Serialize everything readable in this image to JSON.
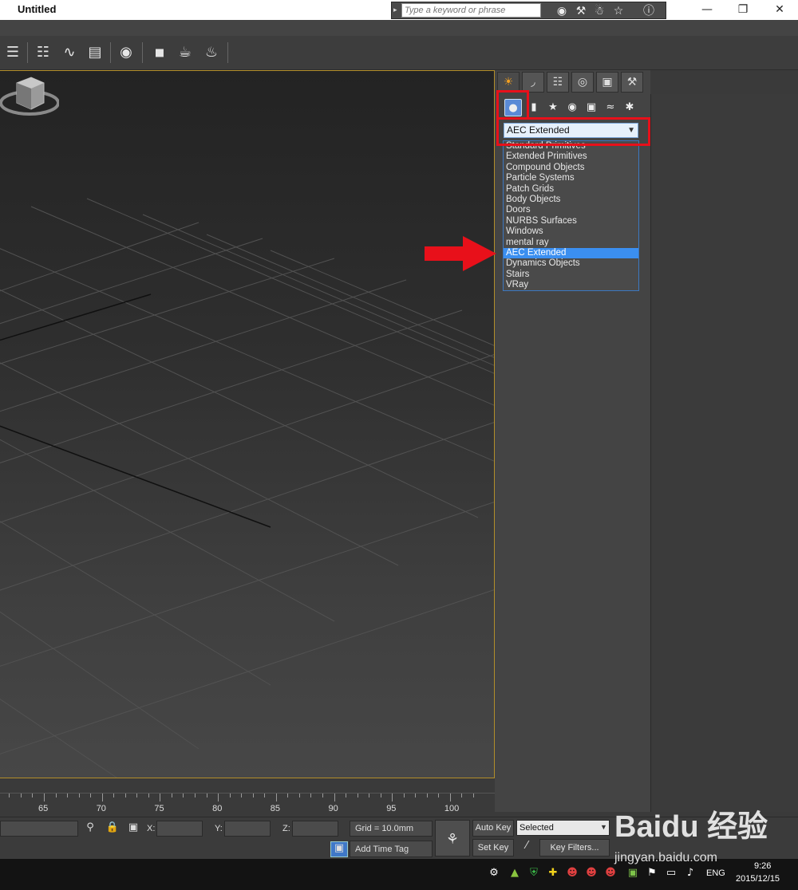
{
  "window": {
    "title": "Untitled",
    "minimize": "—",
    "restore": "❐",
    "close": "✕"
  },
  "search": {
    "placeholder": "Type a keyword or phrase",
    "arrow": "▸",
    "icons": [
      "binoculars-icon",
      "tools-icon",
      "communication-icon",
      "star-icon",
      "help-icon"
    ]
  },
  "toolbar": {
    "icons": [
      "layer-manager-icon",
      "light-lister-icon",
      "curve-editor-icon",
      "schematic-view-icon",
      "material-editor-icon",
      "render-setup-icon",
      "rendered-frame-icon",
      "render-icon",
      "render-iterative-icon"
    ]
  },
  "command_panel": {
    "tabs": [
      "create-tab",
      "modify-tab",
      "hierarchy-tab",
      "motion-tab",
      "display-tab",
      "utilities-tab"
    ],
    "sub_icons": [
      "geometry-icon",
      "shapes-icon",
      "lights-icon",
      "cameras-icon",
      "helpers-icon",
      "space-warps-icon",
      "systems-icon"
    ],
    "dropdown_value": "AEC Extended",
    "options": [
      "Standard Primitives",
      "Extended Primitives",
      "Compound Objects",
      "Particle Systems",
      "Patch Grids",
      "Body Objects",
      "Doors",
      "NURBS Surfaces",
      "Windows",
      "mental ray",
      "AEC Extended",
      "Dynamics Objects",
      "Stairs",
      "VRay"
    ],
    "selected_index": 10
  },
  "timeline": {
    "labels": [
      "65",
      "70",
      "75",
      "80",
      "85",
      "90",
      "95",
      "100"
    ]
  },
  "status": {
    "x_label": "X:",
    "y_label": "Y:",
    "z_label": "Z:",
    "grid": "Grid = 10.0mm",
    "add_time_tag": "Add Time Tag",
    "auto_key": "Auto Key",
    "set_key": "Set Key",
    "selected": "Selected",
    "key_filters": "Key Filters..."
  },
  "taskbar": {
    "lang": "ENG",
    "time": "9:26",
    "date": "2015/12/15"
  },
  "watermark": {
    "brand": "Baidu 经验",
    "url": "jingyan.baidu.com"
  },
  "colors": {
    "highlight_red": "#e8101a",
    "selection_blue": "#3b8ff0",
    "viewport_border": "#b28e2a"
  }
}
